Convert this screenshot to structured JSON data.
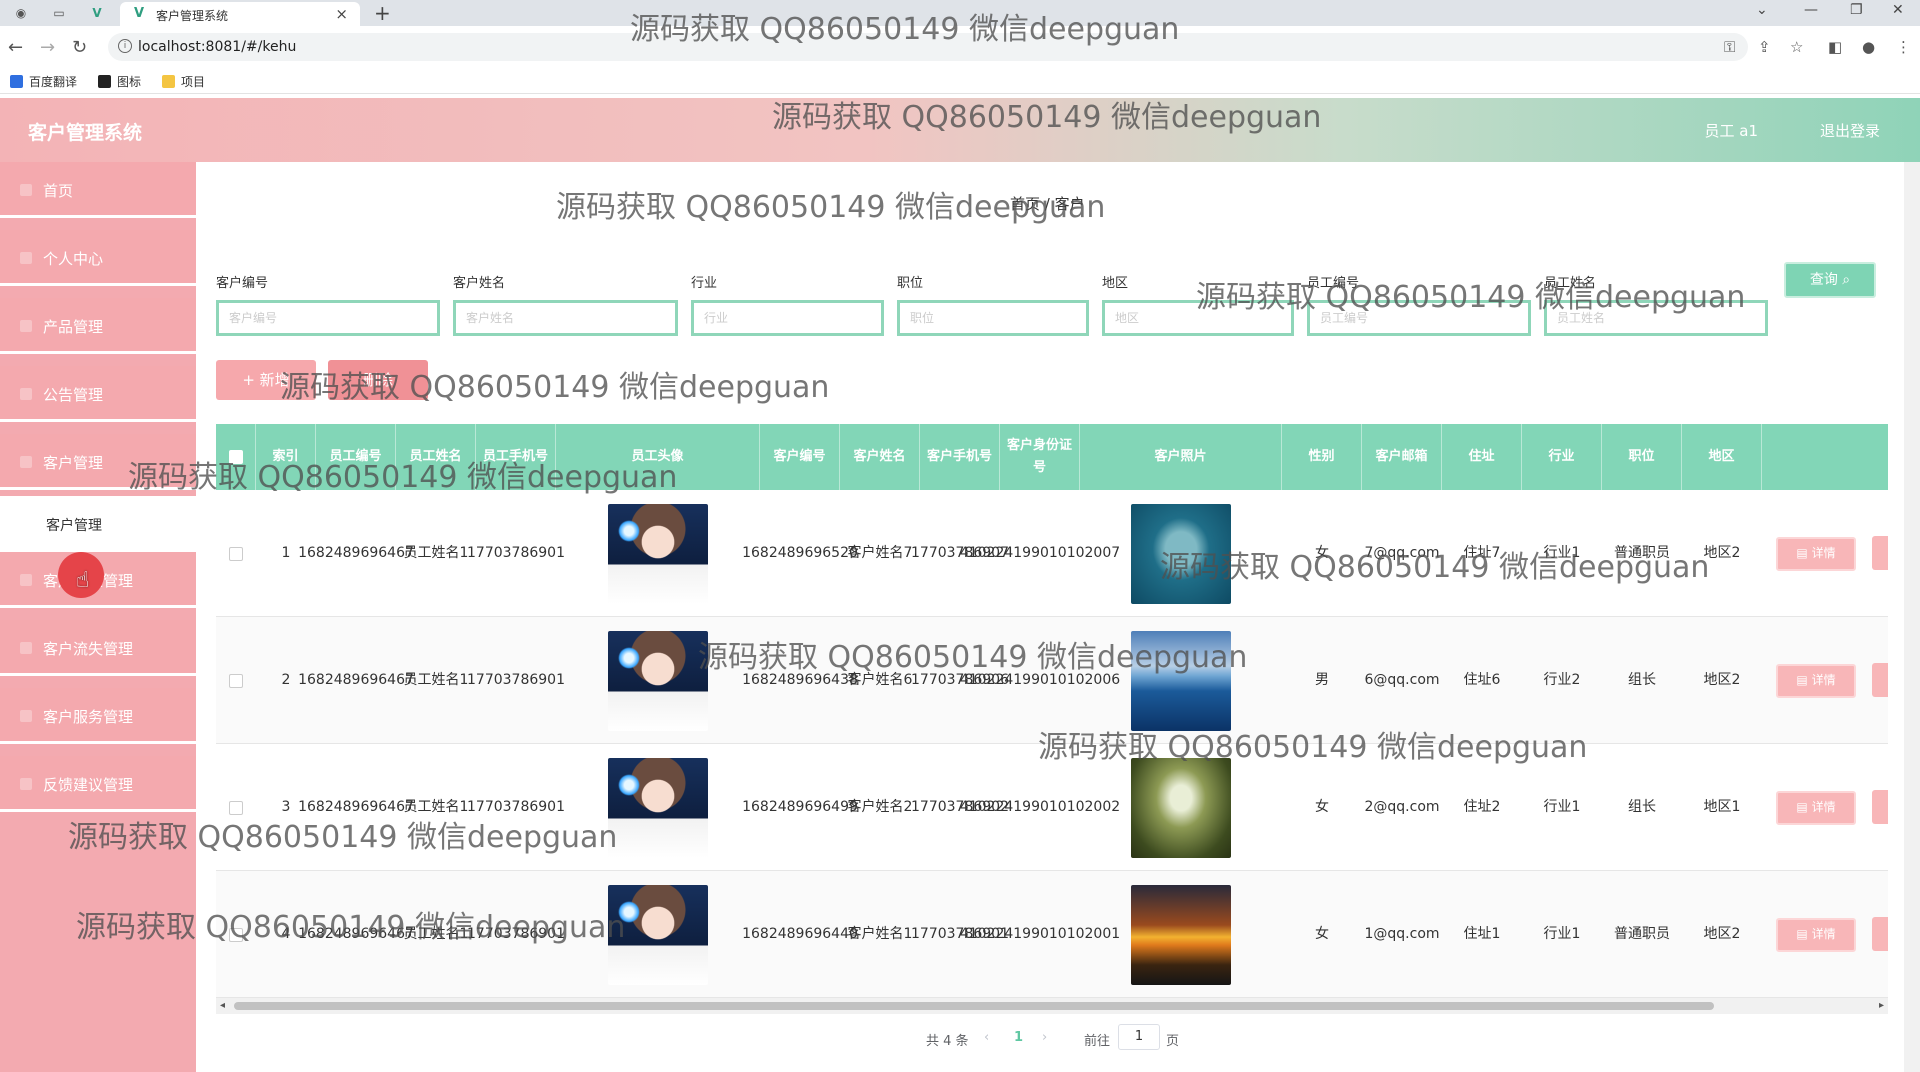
{
  "browser": {
    "tab_title": "客户管理系统",
    "url": "localhost:8081/#/kehu",
    "bookmarks": [
      "百度翻译",
      "图标",
      "项目"
    ]
  },
  "header": {
    "app_title": "客户管理系统",
    "user": "员工 a1",
    "logout": "退出登录"
  },
  "sidebar": {
    "items": [
      {
        "label": "首页"
      },
      {
        "label": "个人中心"
      },
      {
        "label": "产品管理"
      },
      {
        "label": "公告管理"
      },
      {
        "label": "客户管理"
      },
      {
        "label": "客户管理"
      },
      {
        "label": "客户跟进管理"
      },
      {
        "label": "客户流失管理"
      },
      {
        "label": "客户服务管理"
      },
      {
        "label": "反馈建议管理"
      }
    ]
  },
  "breadcrumb": "首页 / 客户",
  "search": {
    "fields": [
      {
        "label": "客户编号",
        "placeholder": "客户编号"
      },
      {
        "label": "客户姓名",
        "placeholder": "客户姓名"
      },
      {
        "label": "行业",
        "placeholder": "行业"
      },
      {
        "label": "职位",
        "placeholder": "职位"
      },
      {
        "label": "地区",
        "placeholder": "地区"
      },
      {
        "label": "员工编号",
        "placeholder": "员工编号"
      },
      {
        "label": "员工姓名",
        "placeholder": "员工姓名"
      }
    ],
    "query_button": "查询"
  },
  "actions": {
    "add": "+ 新增",
    "delete": "删除"
  },
  "table": {
    "headers": [
      "索引",
      "员工编号",
      "员工姓名",
      "员工手机号",
      "员工头像",
      "客户编号",
      "客户姓名",
      "客户手机号",
      "客户身份证号",
      "客户照片",
      "性别",
      "客户邮箱",
      "住址",
      "行业",
      "职位",
      "地区"
    ],
    "rows": [
      {
        "index": "1",
        "emp_no": "1682489696467",
        "emp_name": "员工姓名1",
        "emp_phone": "17703786901",
        "cust_no": "1682489696520",
        "cust_name": "客户姓名7",
        "cust_phone": "17703786907",
        "id_card": "410224199010102007",
        "gender": "女",
        "email": "7@qq.com",
        "address": "住址7",
        "industry": "行业1",
        "position": "普通职员",
        "region": "地区2"
      },
      {
        "index": "2",
        "emp_no": "1682489696467",
        "emp_name": "员工姓名1",
        "emp_phone": "17703786901",
        "cust_no": "1682489696438",
        "cust_name": "客户姓名6",
        "cust_phone": "17703786906",
        "id_card": "410224199010102006",
        "gender": "男",
        "email": "6@qq.com",
        "address": "住址6",
        "industry": "行业2",
        "position": "组长",
        "region": "地区2"
      },
      {
        "index": "3",
        "emp_no": "1682489696467",
        "emp_name": "员工姓名1",
        "emp_phone": "17703786901",
        "cust_no": "1682489696499",
        "cust_name": "客户姓名2",
        "cust_phone": "17703786902",
        "id_card": "410224199010102002",
        "gender": "女",
        "email": "2@qq.com",
        "address": "住址2",
        "industry": "行业1",
        "position": "组长",
        "region": "地区1"
      },
      {
        "index": "4",
        "emp_no": "1682489696467",
        "emp_name": "员工姓名1",
        "emp_phone": "17703786901",
        "cust_no": "1682489696440",
        "cust_name": "客户姓名1",
        "cust_phone": "17703786901",
        "id_card": "410224199010102001",
        "gender": "女",
        "email": "1@qq.com",
        "address": "住址1",
        "industry": "行业1",
        "position": "普通职员",
        "region": "地区2"
      }
    ],
    "detail_button": "详情"
  },
  "pagination": {
    "total": "共 4 条",
    "current": "1",
    "goto_prefix": "前往",
    "goto_value": "1",
    "goto_suffix": "页"
  },
  "watermark": "源码获取 QQ86050149 微信deepguan",
  "colors": {
    "accent_green": "#82d6b7",
    "sidebar_pink": "#f4a9ae",
    "button_pink": "#f8b6b8"
  }
}
